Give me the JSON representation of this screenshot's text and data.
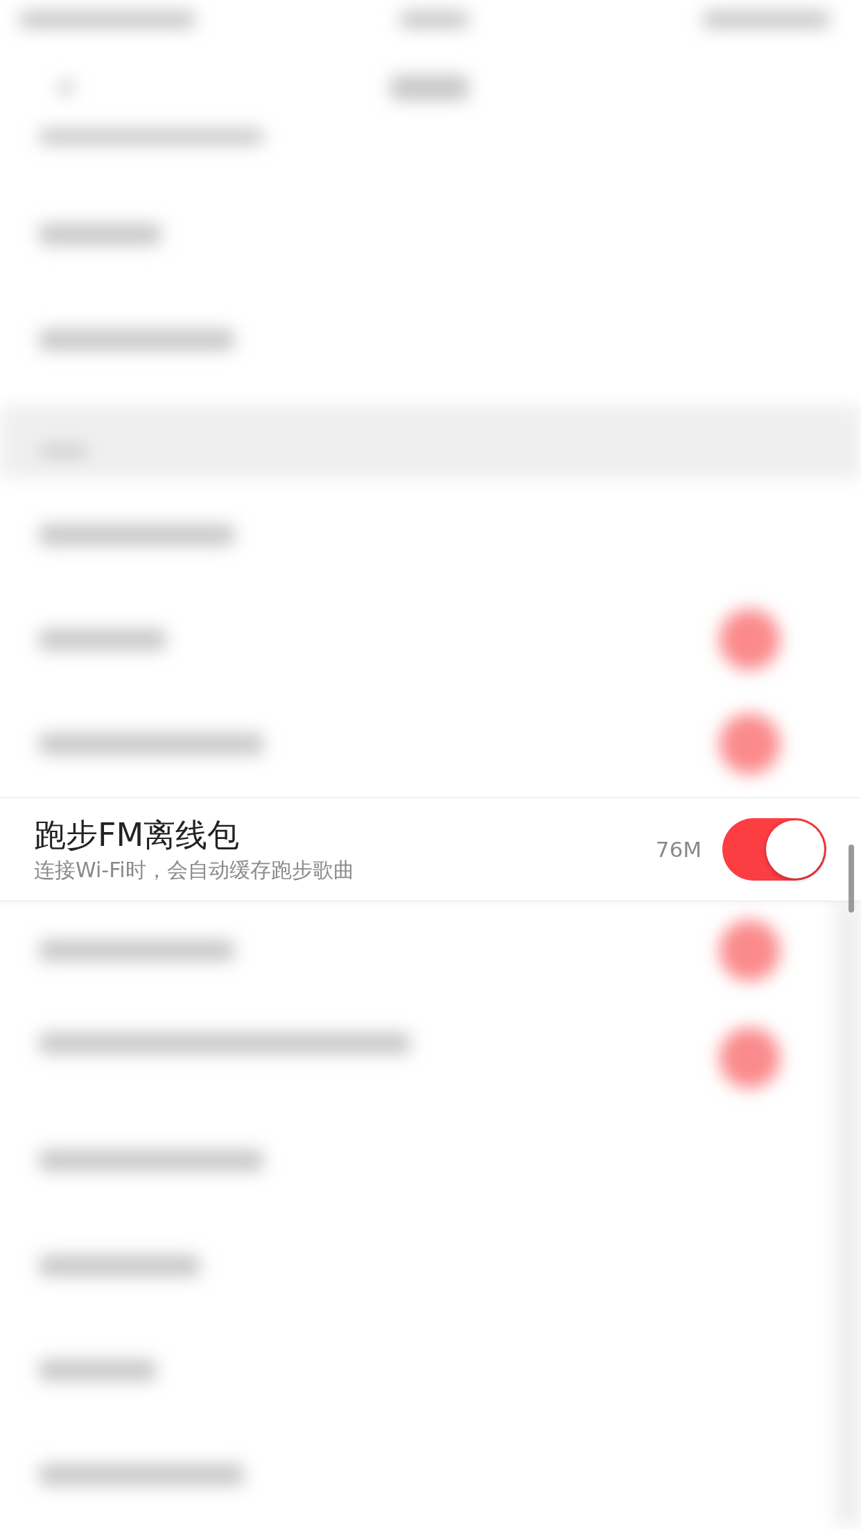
{
  "setting_row": {
    "title": "跑步FM离线包",
    "subtitle": "连接Wi-Fi时，会自动缓存跑步歌曲",
    "size": "76M",
    "on": true
  }
}
